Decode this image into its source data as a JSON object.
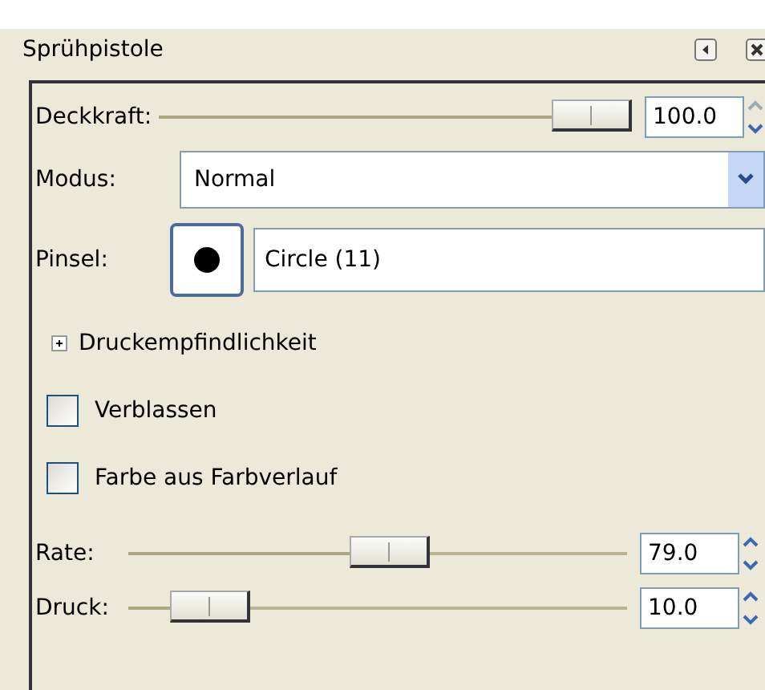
{
  "title": "Sprühpistole",
  "opacity": {
    "label": "Deckkraft:",
    "level": 1.0,
    "value": "100.0"
  },
  "mode": {
    "label": "Modus:",
    "value": "Normal"
  },
  "brush": {
    "label": "Pinsel:",
    "value": "Circle (11)"
  },
  "pressure_section": {
    "label": "Druckempfindlichkeit",
    "expanded": false
  },
  "checkboxes": [
    {
      "label": "Verblassen",
      "checked": false
    },
    {
      "label": "Farbe aus Farbverlauf",
      "checked": false
    }
  ],
  "sliders": [
    {
      "label": "Rate:",
      "level": 0.53,
      "value": "79.0"
    },
    {
      "label": "Druck:",
      "level": 0.1,
      "value": "10.0"
    }
  ]
}
